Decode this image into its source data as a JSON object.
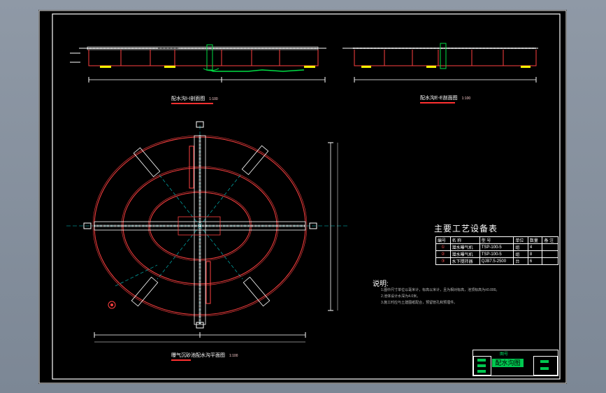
{
  "captions": {
    "section_1": {
      "title": "配水沟I-I剖面图",
      "scale": "1:100"
    },
    "section_2": {
      "title": "配水沟E-E剖面图",
      "scale": "1:100"
    },
    "plan": {
      "title": "曝气沉砂池配水沟平面图",
      "scale": "1:100"
    }
  },
  "equipment_table": {
    "title": "主要工艺设备表",
    "headers": [
      "编号",
      "名  称",
      "型  号",
      "单位",
      "数量",
      "备  注"
    ],
    "rows": [
      {
        "no": "①",
        "name": "潜水曝气机",
        "model": "TSP-100-5",
        "unit": "组",
        "qty": "4",
        "remark": ""
      },
      {
        "no": "②",
        "name": "潜水曝气机",
        "model": "TSP-100-5",
        "unit": "组",
        "qty": "8",
        "remark": ""
      },
      {
        "no": "③",
        "name": "水下搅拌器",
        "model": "QJB7.5-2500",
        "unit": "台",
        "qty": "6",
        "remark": ""
      }
    ]
  },
  "notes": {
    "heading": "说明:",
    "lines": [
      "1.图中尺寸单位以毫米计，标高以米计，且为相对标高，池顶标高为±0.000。",
      "2.池体设计水深为4.0米。",
      "3.施工时应与土建图纸配合，预留管孔和预埋件。"
    ]
  },
  "title_block": {
    "top_label": "图号",
    "drawing_name": "配水沟图"
  },
  "colors": {
    "background": "#000000",
    "frame": "#ffffff",
    "structure": "#ff4040",
    "walls": "#ffffff",
    "water": "#00dd44",
    "axis": "#00cccc",
    "hatch": "#ffff00"
  }
}
